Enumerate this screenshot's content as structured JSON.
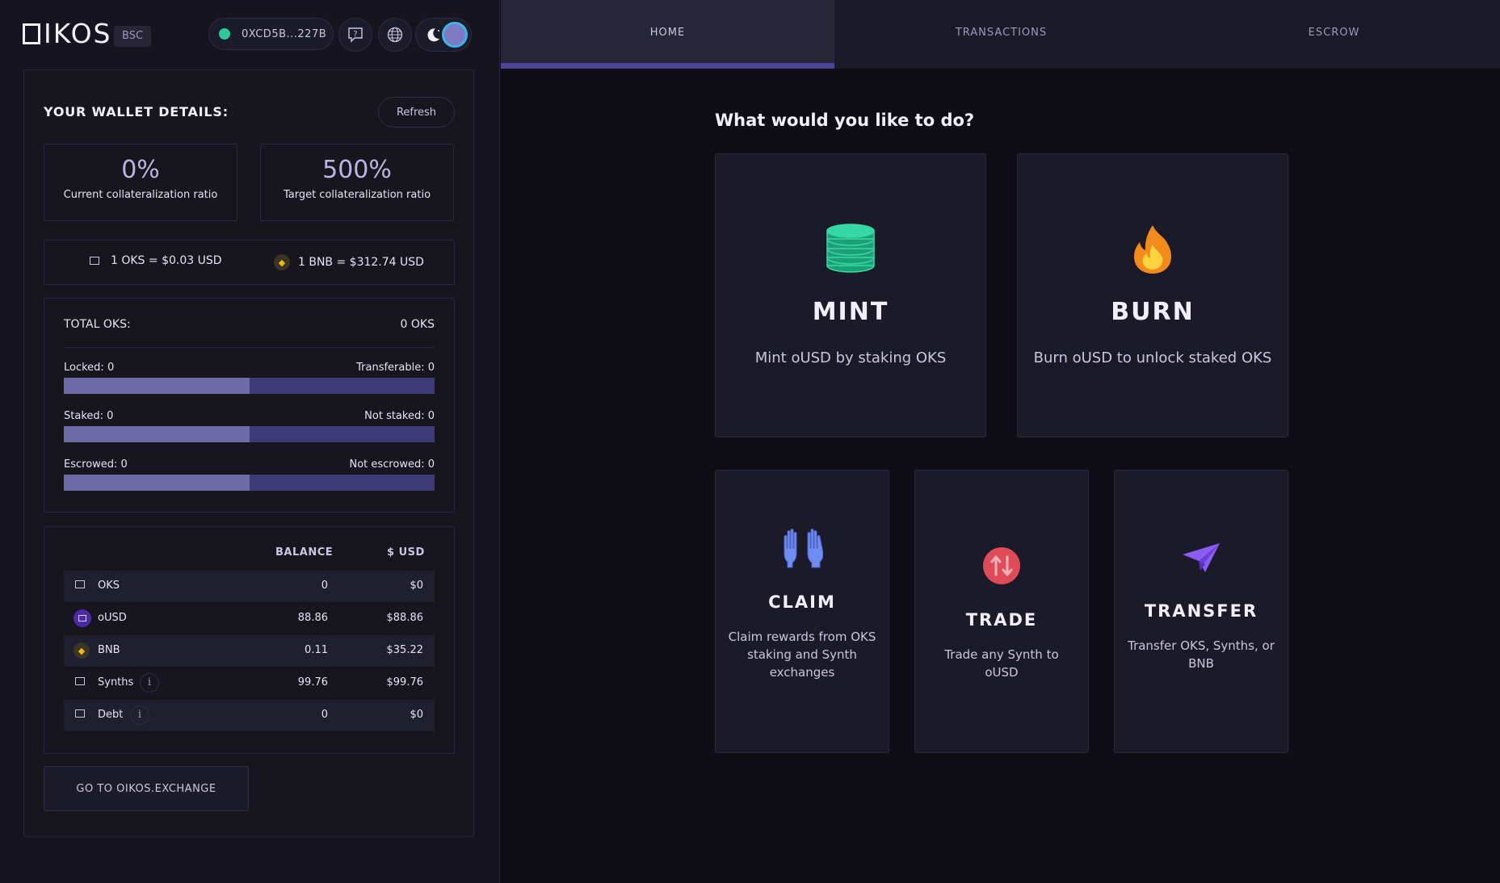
{
  "header": {
    "logo_text": "IKOS",
    "network": "BSC",
    "wallet_address": "0XCD5B...227B",
    "help_icon": "help-icon",
    "language_icon": "globe-icon",
    "theme_icon": "moon-icon"
  },
  "wallet": {
    "title": "YOUR WALLET DETAILS:",
    "refresh_label": "Refresh",
    "current_ratio": {
      "value": "0%",
      "label": "Current collateralization ratio"
    },
    "target_ratio": {
      "value": "500%",
      "label": "Target collateralization ratio"
    },
    "prices": {
      "oks": "1 OKS = $0.03 USD",
      "bnb": "1 BNB = $312.74 USD"
    },
    "total_oks_label": "TOTAL OKS:",
    "total_oks_value": "0 OKS",
    "bars": [
      {
        "left": "Locked: 0",
        "right": "Transferable: 0",
        "fill": 0.5
      },
      {
        "left": "Staked: 0",
        "right": "Not staked: 0",
        "fill": 0.5
      },
      {
        "left": "Escrowed: 0",
        "right": "Not escrowed: 0",
        "fill": 0.5
      }
    ],
    "balances": {
      "col_balance": "BALANCE",
      "col_usd": "$ USD",
      "rows": [
        {
          "name": "OKS",
          "balance": "0",
          "usd": "$0"
        },
        {
          "name": "oUSD",
          "balance": "88.86",
          "usd": "$88.86"
        },
        {
          "name": "BNB",
          "balance": "0.11",
          "usd": "$35.22"
        },
        {
          "name": "Synths",
          "balance": "99.76",
          "usd": "$99.76",
          "info": "i"
        },
        {
          "name": "Debt",
          "balance": "0",
          "usd": "$0",
          "info": "i"
        }
      ]
    },
    "exchange_label": "GO TO OIKOS.EXCHANGE"
  },
  "tabs": [
    "HOME",
    "TRANSACTIONS",
    "ESCROW"
  ],
  "active_tab": "HOME",
  "main": {
    "question": "What would you like to do?",
    "actions": {
      "mint": {
        "title": "MINT",
        "desc": "Mint oUSD by staking OKS",
        "icon": "coins-icon"
      },
      "burn": {
        "title": "BURN",
        "desc": "Burn oUSD to unlock staked OKS",
        "icon": "fire-icon"
      },
      "claim": {
        "title": "CLAIM",
        "desc": "Claim rewards from OKS staking and Synth exchanges",
        "icon": "hands-icon"
      },
      "trade": {
        "title": "TRADE",
        "desc": "Trade any Synth to oUSD",
        "icon": "swap-icon"
      },
      "transfer": {
        "title": "TRANSFER",
        "desc": "Transfer OKS, Synths, or BNB",
        "icon": "paper-plane-icon"
      }
    }
  },
  "colors": {
    "accent": "#4a4597",
    "bar_fill": "#6d6aa8",
    "bar_bg": "#3d3a78",
    "wallet_dot": "#2ec99a"
  }
}
